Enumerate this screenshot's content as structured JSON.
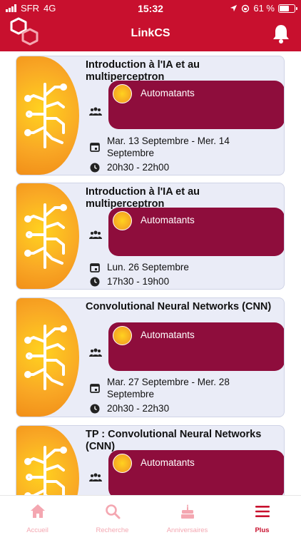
{
  "status_bar": {
    "carrier": "SFR",
    "network": "4G",
    "time": "15:32",
    "battery": "61 %",
    "battery_level": 0.61
  },
  "header": {
    "title": "LinkCS",
    "icons": [
      "linkcs-logo",
      "bell-icon"
    ]
  },
  "events": [
    {
      "title": "Introduction à l'IA et au multiperceptron",
      "association": "Automatants",
      "date": "Mar. 13 Septembre - Mer. 14 Septembre",
      "time": "20h30 - 22h00"
    },
    {
      "title": "Introduction à l'IA et au multiperceptron",
      "association": "Automatants",
      "date": "Lun. 26 Septembre",
      "time": "17h30 - 19h00"
    },
    {
      "title": "Convolutional Neural Networks (CNN)",
      "association": "Automatants",
      "date": "Mar. 27 Septembre - Mer. 28 Septembre",
      "time": "20h30 - 22h30"
    },
    {
      "title": "TP : Convolutional Neural Networks (CNN)",
      "association": "Automatants"
    }
  ],
  "tabs": [
    {
      "label": "Accueil",
      "icon": "home-icon",
      "active": false
    },
    {
      "label": "Recherche",
      "icon": "search-icon",
      "active": false
    },
    {
      "label": "Anniversaires",
      "icon": "cake-icon",
      "active": false
    },
    {
      "label": "Plus",
      "icon": "menu-icon",
      "active": true
    }
  ],
  "colors": {
    "header_red": "#c8102e",
    "association_bg": "#8e0d3c",
    "card_bg": "#eaecf7",
    "tab_inactive": "#f4a7b1",
    "tab_active": "#c8102e"
  }
}
